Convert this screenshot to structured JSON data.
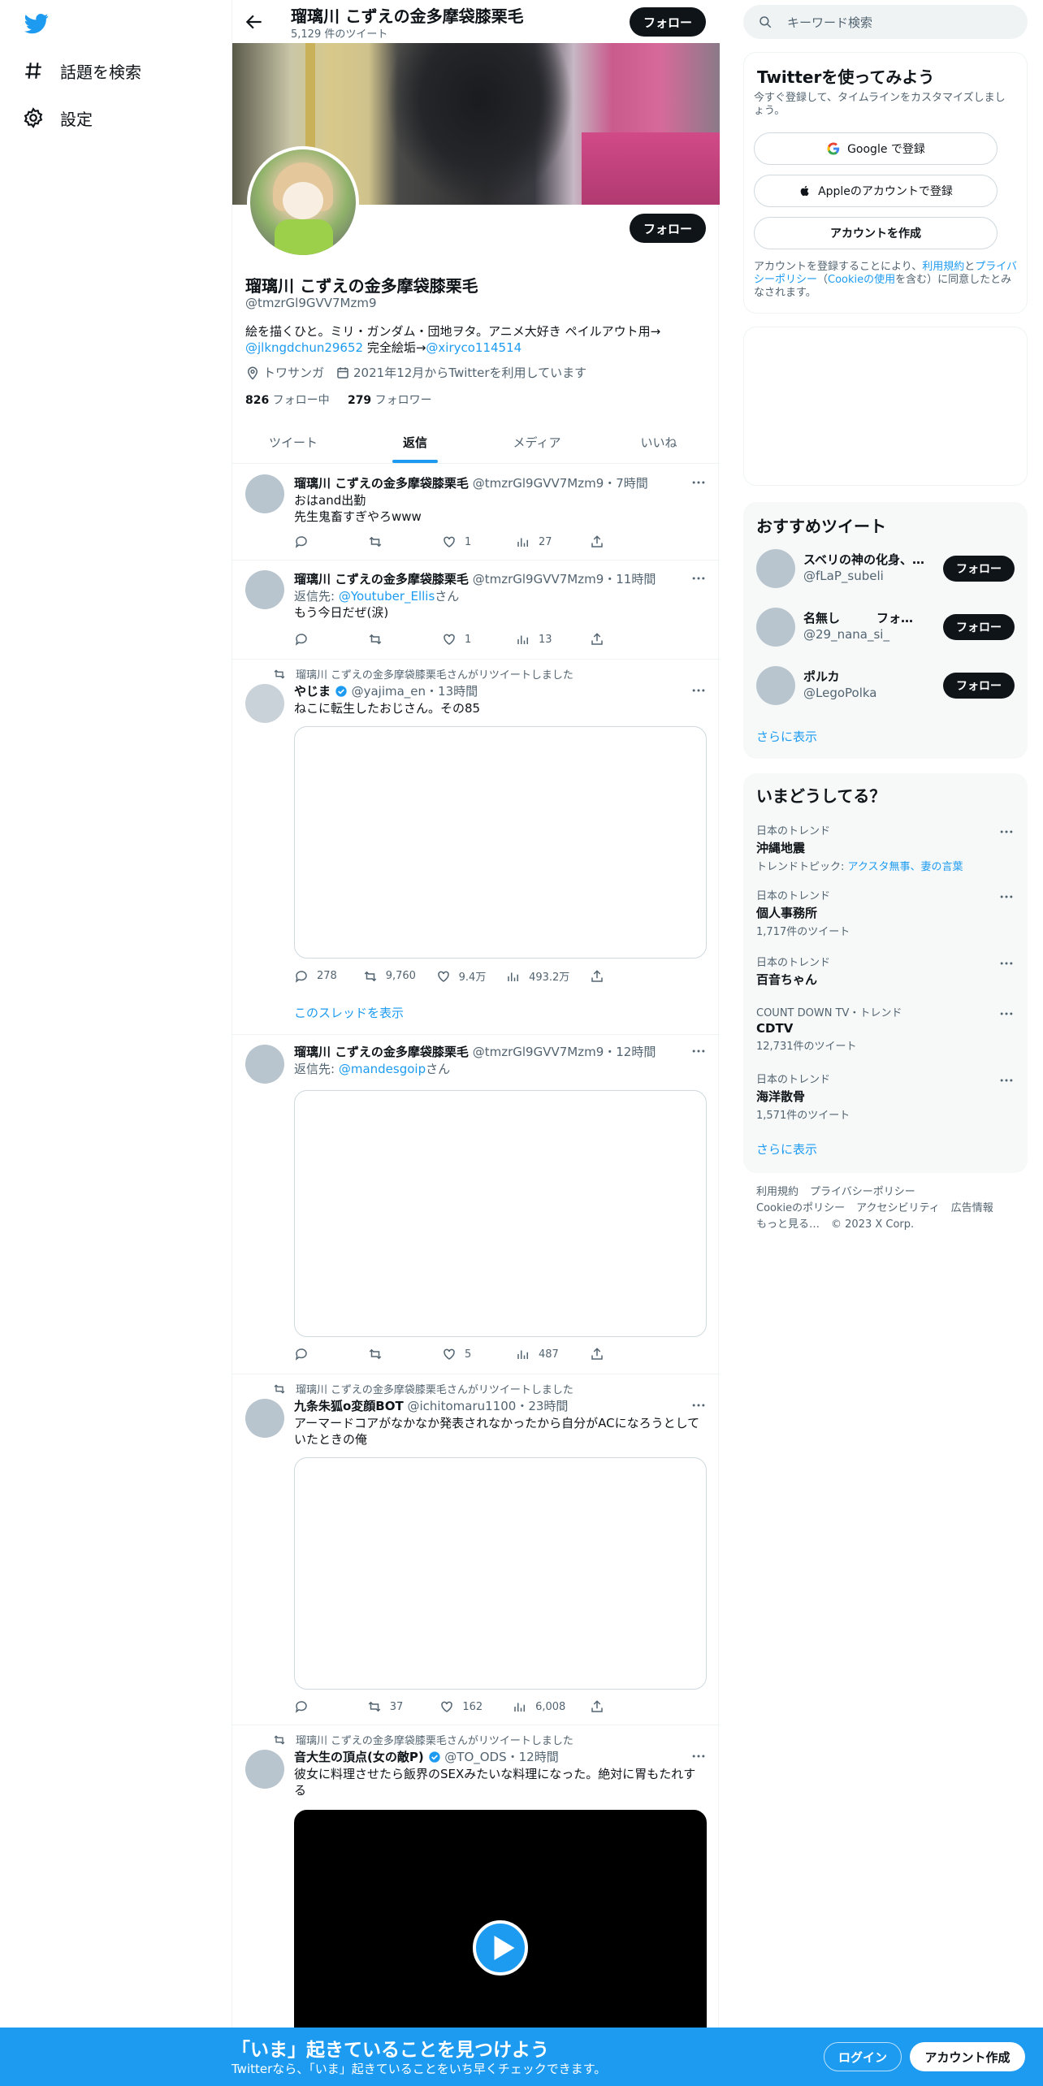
{
  "nav": {
    "explore_label": "話題を検索",
    "settings_label": "設定"
  },
  "profile": {
    "header_name": "瑠璃川 こずえの金多摩袋膝栗毛",
    "tweet_count": "5,129 件のツイート",
    "follow_label": "フォロー",
    "name": "瑠璃川 こずえの金多摩袋膝栗毛",
    "handle": "@tmzrGl9GVV7Mzm9",
    "bio_text1": "絵を描くひと。ミリ・ガンダム・団地ヲタ。アニメ大好き ペイルアウト用→",
    "bio_link1": "@jlkngdchun29652",
    "bio_text2": " 完全絵垢→",
    "bio_link2": "@xiryco114514",
    "location": "トワサンガ",
    "joined": "2021年12月からTwitterを利用しています",
    "following_count": "826",
    "following_label": " フォロー中",
    "followers_count": "279",
    "followers_label": " フォロワー"
  },
  "tabs": [
    "ツイート",
    "返信",
    "メディア",
    "いいね"
  ],
  "tweets": [
    {
      "name": "瑠璃川 こずえの金多摩袋膝栗毛",
      "handle": "@tmzrGl9GVV7Mzm9",
      "time": "・7時間",
      "line1": "おはand出勤",
      "line2": "先生鬼畜すぎやろwww",
      "replies": "",
      "retweets": "",
      "likes": "1",
      "views": "27"
    },
    {
      "name": "瑠璃川 こずえの金多摩袋膝栗毛",
      "handle": "@tmzrGl9GVV7Mzm9",
      "time": "・11時間",
      "reply_prefix": "返信先: ",
      "reply_to": "@Youtuber_Ellis",
      "reply_suffix": "さん",
      "line1": "もう今日だぜ(涙)",
      "replies": "",
      "retweets": "",
      "likes": "1",
      "views": "13"
    },
    {
      "retweet_label": "瑠璃川 こずえの金多摩袋膝栗毛さんがリツイートしました",
      "name": "やじま",
      "handle": "@yajima_en",
      "time": "・13時間",
      "line1": "ねこに転生したおじさん。その85",
      "replies": "278",
      "retweets": "9,760",
      "likes": "9.4万",
      "views": "493.2万",
      "show_thread": "このスレッドを表示"
    },
    {
      "name": "瑠璃川 こずえの金多摩袋膝栗毛",
      "handle": "@tmzrGl9GVV7Mzm9",
      "time": "・12時間",
      "reply_prefix": "返信先: ",
      "reply_to": "@mandesgoip",
      "reply_suffix": "さん",
      "replies": "",
      "retweets": "",
      "likes": "5",
      "views": "487"
    },
    {
      "retweet_label": "瑠璃川 こずえの金多摩袋膝栗毛さんがリツイートしました",
      "name": "九条朱狐o変顔BOT",
      "handle": "@ichitomaru1100",
      "time": "・23時間",
      "line1": "アーマードコアがなかなか発表されなかったから自分がACになろうとしていたときの俺",
      "replies": "",
      "retweets": "37",
      "likes": "162",
      "views": "6,008"
    },
    {
      "retweet_label": "瑠璃川 こずえの金多摩袋膝栗毛さんがリツイートしました",
      "name": "音大生の頂点(女の敵P)",
      "handle": "@TO_ODS",
      "time": "・12時間",
      "line1": "彼女に料理させたら飯界のSEXみたいな料理になった。絶対に胃もたれする"
    }
  ],
  "search": {
    "placeholder": "キーワード検索"
  },
  "signup_card": {
    "title": "Twitterを使ってみよう",
    "subtitle": "今すぐ登録して、タイムラインをカスタマイズしましょう。",
    "google": "Google で登録",
    "apple": "Appleのアカウントで登録",
    "create": "アカウントを作成",
    "terms_pre": "アカウントを登録することにより、",
    "terms_link1": "利用規約",
    "terms_mid": "と",
    "terms_link2": "プライバシーポリシー",
    "terms_paren": "（",
    "terms_link3": "Cookieの使用",
    "terms_post": "を含む）に同意したとみなされます。"
  },
  "recommend": {
    "title": "おすすめツイート",
    "users": [
      {
        "name": "スベリの神の化身、…",
        "handle": "@fLaP_subeli"
      },
      {
        "name": "名無し　　　フォ…",
        "handle": "@29_nana_si_"
      },
      {
        "name": "ポルカ",
        "handle": "@LegoPolka"
      }
    ],
    "follow_label": "フォロー",
    "show_more": "さらに表示"
  },
  "trends": {
    "title": "いまどうしてる？",
    "items": [
      {
        "category": "日本のトレンド",
        "topic": "沖縄地震",
        "extra_pre": "トレンドトピック: ",
        "extra_link": "アクスタ無事、妻の言葉"
      },
      {
        "category": "日本のトレンド",
        "topic": "個人事務所",
        "count": "1,717件のツイート"
      },
      {
        "category": "日本のトレンド",
        "topic": "百音ちゃん"
      },
      {
        "category": "COUNT DOWN TV・トレンド",
        "topic": "CDTV",
        "count": "12,731件のツイート"
      },
      {
        "category": "日本のトレンド",
        "topic": "海洋散骨",
        "count": "1,571件のツイート"
      }
    ],
    "show_more": "さらに表示"
  },
  "footer": {
    "links": [
      "利用規約",
      "プライバシーポリシー",
      "Cookieのポリシー",
      "アクセシビリティ",
      "広告情報",
      "もっと見る…",
      "© 2023 X Corp."
    ]
  },
  "bottom": {
    "headline": "「いま」起きていることを見つけよう",
    "sub": "Twitterなら、「いま」起きていることをいち早くチェックできます。",
    "login": "ログイン",
    "signup": "アカウント作成"
  },
  "colors": {
    "accent": "#1d9bf0",
    "text": "#0f1419",
    "secondary": "#536471"
  }
}
